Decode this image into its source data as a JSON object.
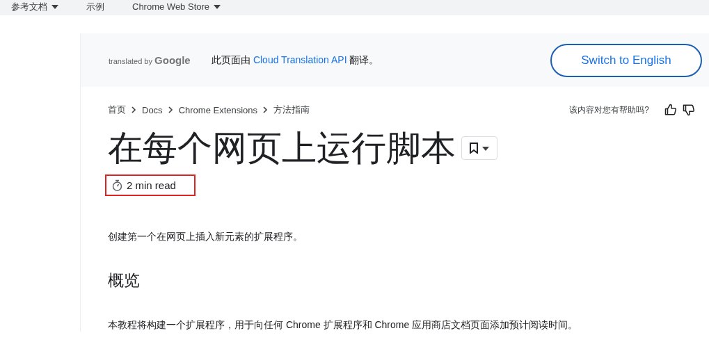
{
  "top_nav": [
    {
      "label": "参考文档",
      "dropdown": true
    },
    {
      "label": "示例",
      "dropdown": false
    },
    {
      "label": "Chrome Web Store",
      "dropdown": true
    }
  ],
  "translation_banner": {
    "attribution_prefix": "translated by",
    "attribution_brand": "Google",
    "message_before": "此页面由",
    "link": "Cloud Translation API",
    "message_after": "翻译。",
    "button": "Switch to English"
  },
  "breadcrumbs": [
    "首页",
    "Docs",
    "Chrome Extensions",
    "方法指南"
  ],
  "feedback": {
    "question": "该内容对您有帮助吗?"
  },
  "title": "在每个网页上运行脚本",
  "reading_time": {
    "text": "2 min read",
    "highlighted": true
  },
  "intro": "创建第一个在网页上插入新元素的扩展程序。",
  "section_heading": "概览",
  "section_text": "本教程将构建一个扩展程序，用于向任何 Chrome 扩展程序和 Chrome 应用商店文档页面添加预计阅读时间。"
}
